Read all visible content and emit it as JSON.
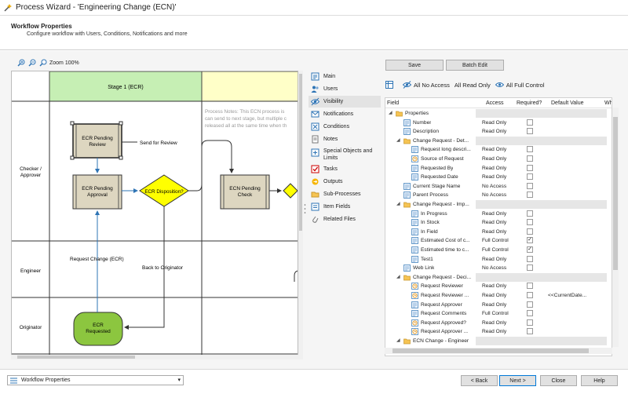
{
  "window": {
    "title": "Process Wizard - 'Engineering Change (ECN)'"
  },
  "header": {
    "title": "Workflow Properties",
    "subtitle": "Configure workflow with Users, Conditions, Notifications and more"
  },
  "zoom": {
    "label": "Zoom 100%"
  },
  "diagram": {
    "stage_label": "Stage 1 (ECR)",
    "lanes": [
      "Checker / Approver",
      "Engineer",
      "Originator"
    ],
    "lane_checker_1": "Checker /",
    "lane_checker_2": "Approver",
    "nodes": {
      "pending_review_1": "ECR Pending",
      "pending_review_2": "Review",
      "pending_approval_1": "ECR Pending",
      "pending_approval_2": "Approval",
      "disposition": "ECR Disposition?",
      "ecn_check_1": "ECN Pending",
      "ecn_check_2": "Check",
      "requested_1": "ECR",
      "requested_2": "Requested"
    },
    "edges": {
      "send_for_review": "Send for Review",
      "request_change": "Request Change (ECR)",
      "back_to_originator": "Back to Originator"
    },
    "notes_1": "Process Notes: This ECN process is",
    "notes_2": "can send to next stage, but multiple c",
    "notes_3": "released all at the same time when th"
  },
  "menu": {
    "items": [
      {
        "label": "Main",
        "icon": "main-icon"
      },
      {
        "label": "Users",
        "icon": "users-icon"
      },
      {
        "label": "Visibility",
        "icon": "visibility-icon"
      },
      {
        "label": "Notifications",
        "icon": "notifications-icon"
      },
      {
        "label": "Conditions",
        "icon": "conditions-icon"
      },
      {
        "label": "Notes",
        "icon": "notes-icon"
      },
      {
        "label": "Special Objects and Limits",
        "icon": "special-objects-icon"
      },
      {
        "label": "Tasks",
        "icon": "tasks-icon"
      },
      {
        "label": "Outputs",
        "icon": "outputs-icon"
      },
      {
        "label": "Sub-Processes",
        "icon": "sub-processes-icon"
      },
      {
        "label": "Item Fields",
        "icon": "item-fields-icon"
      },
      {
        "label": "Related Files",
        "icon": "related-files-icon"
      }
    ],
    "special_1": "Special Objects and",
    "special_2": "Limits"
  },
  "toolbar": {
    "save": "Save",
    "batch_edit": "Batch Edit",
    "all_no_access": "All No Access",
    "all_read_only": "All Read Only",
    "all_full_control": "All Full Control"
  },
  "grid": {
    "columns": {
      "field": "Field",
      "access": "Access",
      "required": "Required?",
      "default": "Default Value",
      "extra": "Wh"
    },
    "rows": [
      {
        "level": 0,
        "toggle": "◢",
        "icon": "folder",
        "name": "Properties",
        "access": "",
        "cb": false,
        "checked": false,
        "dv": ""
      },
      {
        "level": 1,
        "toggle": "",
        "icon": "field",
        "name": "Number",
        "access": "Read Only",
        "cb": true,
        "checked": false,
        "dv": ""
      },
      {
        "level": 1,
        "toggle": "",
        "icon": "field",
        "name": "Description",
        "access": "Read Only",
        "cb": true,
        "checked": false,
        "dv": ""
      },
      {
        "level": 1,
        "toggle": "◢",
        "icon": "folder",
        "name": "Change Request - Det...",
        "access": "",
        "cb": false,
        "checked": false,
        "dv": ""
      },
      {
        "level": 2,
        "toggle": "",
        "icon": "field",
        "name": "Request long descri...",
        "access": "Read Only",
        "cb": true,
        "checked": false,
        "dv": ""
      },
      {
        "level": 2,
        "toggle": "",
        "icon": "clock",
        "name": "Source of Request",
        "access": "Read Only",
        "cb": true,
        "checked": false,
        "dv": ""
      },
      {
        "level": 2,
        "toggle": "",
        "icon": "field",
        "name": "Requested By",
        "access": "Read Only",
        "cb": true,
        "checked": false,
        "dv": ""
      },
      {
        "level": 2,
        "toggle": "",
        "icon": "field",
        "name": "Requested Date",
        "access": "Read Only",
        "cb": true,
        "checked": false,
        "dv": ""
      },
      {
        "level": 1,
        "toggle": "",
        "icon": "field",
        "name": "Current Stage Name",
        "access": "No Access",
        "cb": true,
        "checked": false,
        "dv": ""
      },
      {
        "level": 1,
        "toggle": "",
        "icon": "field",
        "name": "Parent Process",
        "access": "No Access",
        "cb": true,
        "checked": false,
        "dv": ""
      },
      {
        "level": 1,
        "toggle": "◢",
        "icon": "folder",
        "name": "Change Request - Imp...",
        "access": "",
        "cb": false,
        "checked": false,
        "dv": ""
      },
      {
        "level": 2,
        "toggle": "",
        "icon": "field",
        "name": "In Progress",
        "access": "Read Only",
        "cb": true,
        "checked": false,
        "dv": ""
      },
      {
        "level": 2,
        "toggle": "",
        "icon": "field",
        "name": "In Stock",
        "access": "Read Only",
        "cb": true,
        "checked": false,
        "dv": ""
      },
      {
        "level": 2,
        "toggle": "",
        "icon": "field",
        "name": "In Field",
        "access": "Read Only",
        "cb": true,
        "checked": false,
        "dv": ""
      },
      {
        "level": 2,
        "toggle": "",
        "icon": "field",
        "name": "Estimated Cost of c...",
        "access": "Full Control",
        "cb": true,
        "checked": true,
        "dv": ""
      },
      {
        "level": 2,
        "toggle": "",
        "icon": "field",
        "name": "Estimated time to c...",
        "access": "Full Control",
        "cb": true,
        "checked": true,
        "dv": ""
      },
      {
        "level": 2,
        "toggle": "",
        "icon": "field",
        "name": "Test1",
        "access": "Read Only",
        "cb": true,
        "checked": false,
        "dv": ""
      },
      {
        "level": 1,
        "toggle": "",
        "icon": "field",
        "name": "Web Link",
        "access": "No Access",
        "cb": true,
        "checked": false,
        "dv": ""
      },
      {
        "level": 1,
        "toggle": "◢",
        "icon": "folder",
        "name": "Change Request - Deci...",
        "access": "",
        "cb": false,
        "checked": false,
        "dv": ""
      },
      {
        "level": 2,
        "toggle": "",
        "icon": "clock",
        "name": "Request Reviewer",
        "access": "Read Only",
        "cb": true,
        "checked": false,
        "dv": ""
      },
      {
        "level": 2,
        "toggle": "",
        "icon": "clock",
        "name": "Request Reviewer ...",
        "access": "Read Only",
        "cb": true,
        "checked": false,
        "dv": "<<CurrentDate..."
      },
      {
        "level": 2,
        "toggle": "",
        "icon": "field",
        "name": "Request Approver",
        "access": "Read Only",
        "cb": true,
        "checked": false,
        "dv": ""
      },
      {
        "level": 2,
        "toggle": "",
        "icon": "field",
        "name": "Request Comments",
        "access": "Full Control",
        "cb": true,
        "checked": false,
        "dv": ""
      },
      {
        "level": 2,
        "toggle": "",
        "icon": "clock",
        "name": "Request Approved?",
        "access": "Read Only",
        "cb": true,
        "checked": false,
        "dv": ""
      },
      {
        "level": 2,
        "toggle": "",
        "icon": "clock",
        "name": "Request Approver ...",
        "access": "Read Only",
        "cb": true,
        "checked": false,
        "dv": ""
      },
      {
        "level": 1,
        "toggle": "◢",
        "icon": "folder",
        "name": "ECN Change - Engineer",
        "access": "",
        "cb": false,
        "checked": false,
        "dv": ""
      }
    ]
  },
  "footer": {
    "combo_value": "Workflow Properties",
    "back": "< Back",
    "next": "Next >",
    "close": "Close",
    "help": "Help"
  },
  "colors": {
    "stage_header": "#c6efb4",
    "stage2_header": "#ffffc8",
    "node_fill": "#ddd6c0",
    "decision": "#ffff00",
    "start_node": "#8cc63f",
    "edge": "#2e74b5"
  }
}
